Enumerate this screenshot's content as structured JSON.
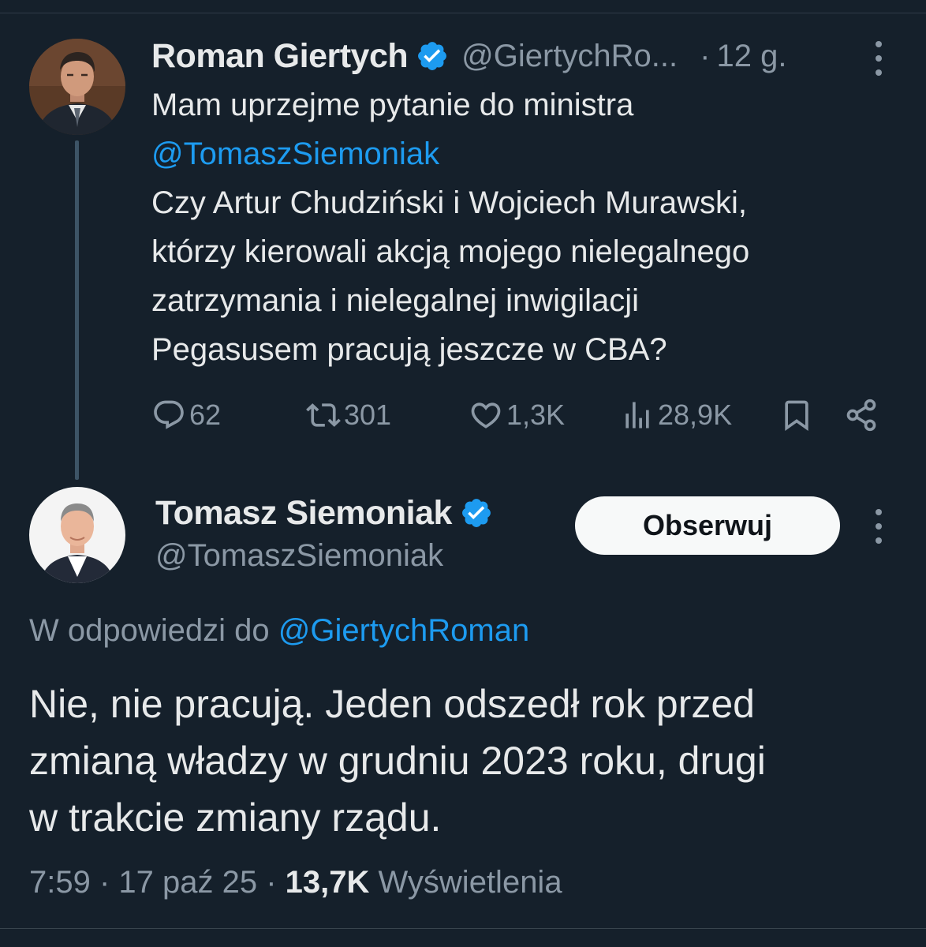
{
  "parent_tweet": {
    "author": {
      "display_name": "Roman Giertych",
      "handle": "@GiertychRo...",
      "verified": true,
      "avatar": "giertych-avatar"
    },
    "separator": "·",
    "time": "12 g.",
    "more_icon": "more-vertical-icon",
    "text_lines": [
      "Mam uprzejme pytanie do ministra",
      "@TomaszSiemoniak",
      "Czy Artur Chudziński i Wojciech Murawski,",
      "którzy kierowali akcją mojego nielegalnego",
      "zatrzymania i nielegalnej inwigilacji",
      "Pegasusem pracują jeszcze w CBA?"
    ],
    "actions": {
      "replies": "62",
      "retweets": "301",
      "likes": "1,3K",
      "views": "28,9K"
    }
  },
  "reply_tweet": {
    "author": {
      "display_name": "Tomasz Siemoniak",
      "handle": "@TomaszSiemoniak",
      "verified": true,
      "avatar": "siemoniak-avatar"
    },
    "follow_label": "Obserwuj",
    "replying_to_prefix": "W odpowiedzi do ",
    "replying_to_handle": "@GiertychRoman",
    "text_lines": [
      "Nie, nie pracują. Jeden odszedł rok przed",
      "zmianą władzy w grudniu 2023 roku, drugi",
      "w trakcie zmiany rządu."
    ],
    "timestamp": "7:59 · 17 paź 25 · ",
    "views_count": "13,7K",
    "views_label": " Wyświetlenia"
  },
  "colors": {
    "background": "#15202b",
    "text": "#e7e9ea",
    "secondary": "#8b98a5",
    "accent": "#1d9bf0",
    "follow_bg": "#f7f9f9"
  }
}
